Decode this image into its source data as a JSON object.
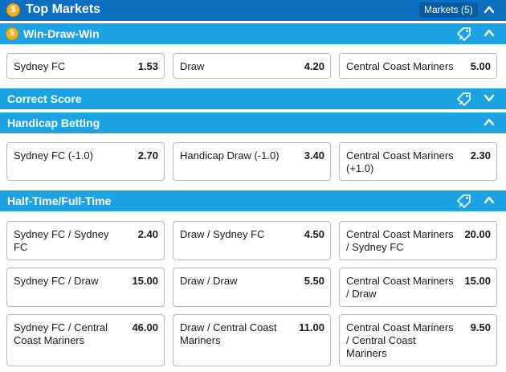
{
  "header": {
    "title": "Top Markets",
    "markets_badge": "Markets (5)"
  },
  "sections": [
    {
      "title": "Win-Draw-Win",
      "has_coin": true,
      "expanded": true,
      "outcomes": [
        {
          "selection": "Sydney FC",
          "price": "1.53"
        },
        {
          "selection": "Draw",
          "price": "4.20"
        },
        {
          "selection": "Central Coast Mariners",
          "price": "5.00"
        }
      ]
    },
    {
      "title": "Correct Score",
      "has_coin": false,
      "expanded": false,
      "outcomes": []
    },
    {
      "title": "Handicap Betting",
      "has_coin": false,
      "expanded": true,
      "outcomes": [
        {
          "selection": "Sydney FC (-1.0)",
          "price": "2.70"
        },
        {
          "selection": "Handicap Draw (-1.0)",
          "price": "3.40"
        },
        {
          "selection": "Central Coast Mariners (+1.0)",
          "price": "2.30"
        }
      ]
    },
    {
      "title": "Half-Time/Full-Time",
      "has_coin": false,
      "expanded": true,
      "outcomes": [
        {
          "selection": "Sydney FC / Sydney FC",
          "price": "2.40"
        },
        {
          "selection": "Draw / Sydney FC",
          "price": "4.50"
        },
        {
          "selection": "Central Coast Mariners / Sydney FC",
          "price": "20.00"
        },
        {
          "selection": "Sydney FC / Draw",
          "price": "15.00"
        },
        {
          "selection": "Draw / Draw",
          "price": "5.50"
        },
        {
          "selection": "Central Coast Mariners / Draw",
          "price": "15.00"
        },
        {
          "selection": "Sydney FC / Central Coast Mariners",
          "price": "46.00"
        },
        {
          "selection": "Draw / Central Coast Mariners",
          "price": "11.00"
        },
        {
          "selection": "Central Coast Mariners / Central Coast Mariners",
          "price": "9.50"
        }
      ]
    }
  ],
  "icons": {
    "coin": "dollar-coin-icon",
    "expand": "chevron-up-icon",
    "collapse": "chevron-down-icon",
    "bet_builder": "ticket-tag-icon"
  },
  "colors": {
    "header_bg": "#0c6fc0",
    "section_bg": "#1ba3e4",
    "coin": "#f5b21a",
    "card_border": "#b8b8b8"
  }
}
